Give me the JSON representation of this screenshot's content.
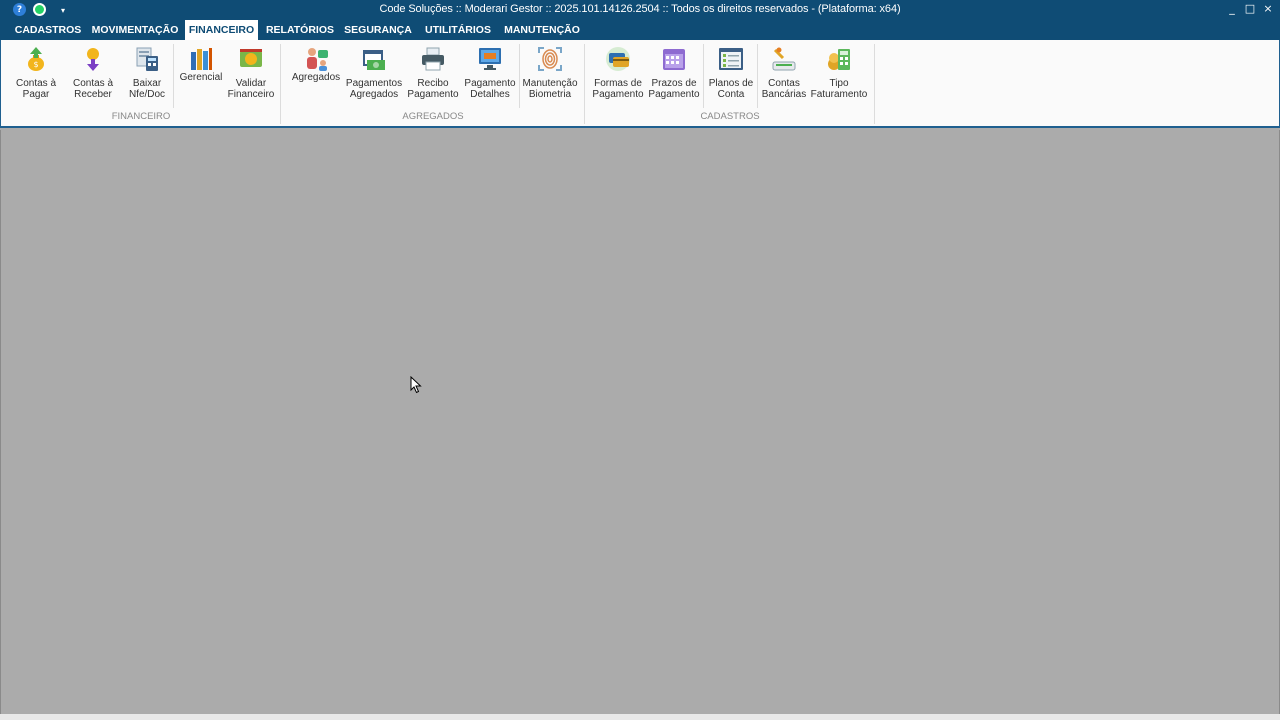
{
  "window": {
    "title": "Code Soluções :: Moderari Gestor :: 2025.101.14126.2504 :: Todos os direitos reservados - (Plataforma: x64)",
    "quick_access": {
      "help": "?",
      "dropdown": "▾"
    },
    "controls": {
      "minimize": "_",
      "maximize": "□",
      "close": "×"
    }
  },
  "menu": {
    "tabs": [
      {
        "label": "CADASTROS"
      },
      {
        "label": "MOVIMENTAÇÃO"
      },
      {
        "label": "FINANCEIRO",
        "active": true
      },
      {
        "label": "RELATÓRIOS"
      },
      {
        "label": "SEGURANÇA"
      },
      {
        "label": "UTILITÁRIOS"
      },
      {
        "label": "MANUTENÇÃO"
      }
    ]
  },
  "ribbon": {
    "groups": [
      {
        "label": "FINANCEIRO",
        "buttons": [
          {
            "label": "Contas à\nPagar",
            "icon": "money-bag-up-icon"
          },
          {
            "label": "Contas à\nReceber",
            "icon": "money-bag-down-icon"
          },
          {
            "label": "Baixar\nNfe/Doc",
            "icon": "document-calculator-icon"
          },
          {
            "label": "Gerencial",
            "icon": "books-icon"
          },
          {
            "label": "Validar\nFinanceiro",
            "icon": "cash-validate-icon"
          }
        ]
      },
      {
        "label": "AGREGADOS",
        "buttons": [
          {
            "label": "Agregados",
            "icon": "people-icon"
          },
          {
            "label": "Pagamentos\nAgregados",
            "icon": "calendar-money-icon"
          },
          {
            "label": "Recibo\nPagamento",
            "icon": "printer-icon"
          },
          {
            "label": "Pagamento\nDetalhes",
            "icon": "monitor-money-icon"
          },
          {
            "label": "Manutenção\nBiometria",
            "icon": "fingerprint-icon"
          }
        ]
      },
      {
        "label": "CADASTROS",
        "buttons": [
          {
            "label": "Formas de\nPagamento",
            "icon": "payment-cards-icon"
          },
          {
            "label": "Prazos de\nPagamento",
            "icon": "calendar-icon"
          },
          {
            "label": "Planos de\nConta",
            "icon": "checklist-icon"
          },
          {
            "label": "Contas\nBancárias",
            "icon": "bank-hand-icon"
          },
          {
            "label": "Tipo\nFaturamento",
            "icon": "invoice-calculator-icon"
          }
        ]
      }
    ]
  },
  "colors": {
    "title_bar": "#0f4c75",
    "ribbon_bg": "#fafafa",
    "workspace": "#ababab",
    "group_label": "#888888"
  }
}
